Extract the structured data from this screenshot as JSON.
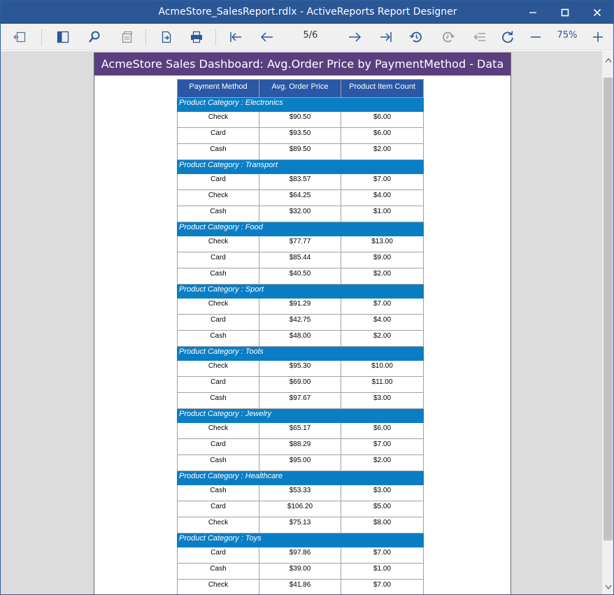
{
  "window": {
    "title": "AcmeStore_SalesReport.rdlx - ActiveReports Report Designer"
  },
  "toolbar": {
    "page_indicator": "5/6",
    "zoom": "75%",
    "icons": [
      "sidebar-toggle-icon",
      "panel-icon",
      "search-icon",
      "pages-icon",
      "export-icon",
      "print-icon",
      "first-page-icon",
      "previous-page-icon",
      "next-page-icon",
      "last-page-icon",
      "history-back-icon",
      "history-forward-icon",
      "back-to-parent-icon",
      "refresh-icon",
      "zoom-out-icon",
      "zoom-in-icon"
    ]
  },
  "report": {
    "header_title": "AcmeStore Sales Dashboard: Avg.Order Price by PaymentMethod - Data",
    "columns": [
      "Payment Method",
      "Avg. Order Price",
      "Product Item Count"
    ],
    "groups": [
      {
        "label": "Product Category : Electronics",
        "rows": [
          [
            "Check",
            "$90.50",
            "$6.00"
          ],
          [
            "Card",
            "$93.50",
            "$6.00"
          ],
          [
            "Cash",
            "$89.50",
            "$2.00"
          ]
        ]
      },
      {
        "label": "Product Category : Transport",
        "rows": [
          [
            "Card",
            "$83.57",
            "$7.00"
          ],
          [
            "Check",
            "$64.25",
            "$4.00"
          ],
          [
            "Cash",
            "$32.00",
            "$1.00"
          ]
        ]
      },
      {
        "label": "Product Category : Food",
        "rows": [
          [
            "Check",
            "$77.77",
            "$13.00"
          ],
          [
            "Card",
            "$85.44",
            "$9.00"
          ],
          [
            "Cash",
            "$40.50",
            "$2.00"
          ]
        ]
      },
      {
        "label": "Product Category : Sport",
        "rows": [
          [
            "Check",
            "$91.29",
            "$7.00"
          ],
          [
            "Card",
            "$42.75",
            "$4.00"
          ],
          [
            "Cash",
            "$48.00",
            "$2.00"
          ]
        ]
      },
      {
        "label": "Product Category : Tools",
        "rows": [
          [
            "Check",
            "$95.30",
            "$10.00"
          ],
          [
            "Card",
            "$69.00",
            "$11.00"
          ],
          [
            "Cash",
            "$97.67",
            "$3.00"
          ]
        ]
      },
      {
        "label": "Product Category : Jewelry",
        "rows": [
          [
            "Check",
            "$65.17",
            "$6.00"
          ],
          [
            "Card",
            "$88.29",
            "$7.00"
          ],
          [
            "Cash",
            "$95.00",
            "$2.00"
          ]
        ]
      },
      {
        "label": "Product Category : Healthcare",
        "rows": [
          [
            "Cash",
            "$53.33",
            "$3.00"
          ],
          [
            "Card",
            "$106.20",
            "$5.00"
          ],
          [
            "Check",
            "$75.13",
            "$8.00"
          ]
        ]
      },
      {
        "label": "Product Category : Toys",
        "rows": [
          [
            "Card",
            "$97.86",
            "$7.00"
          ],
          [
            "Cash",
            "$39.00",
            "$1.00"
          ],
          [
            "Check",
            "$41.86",
            "$7.00"
          ]
        ]
      }
    ]
  }
}
